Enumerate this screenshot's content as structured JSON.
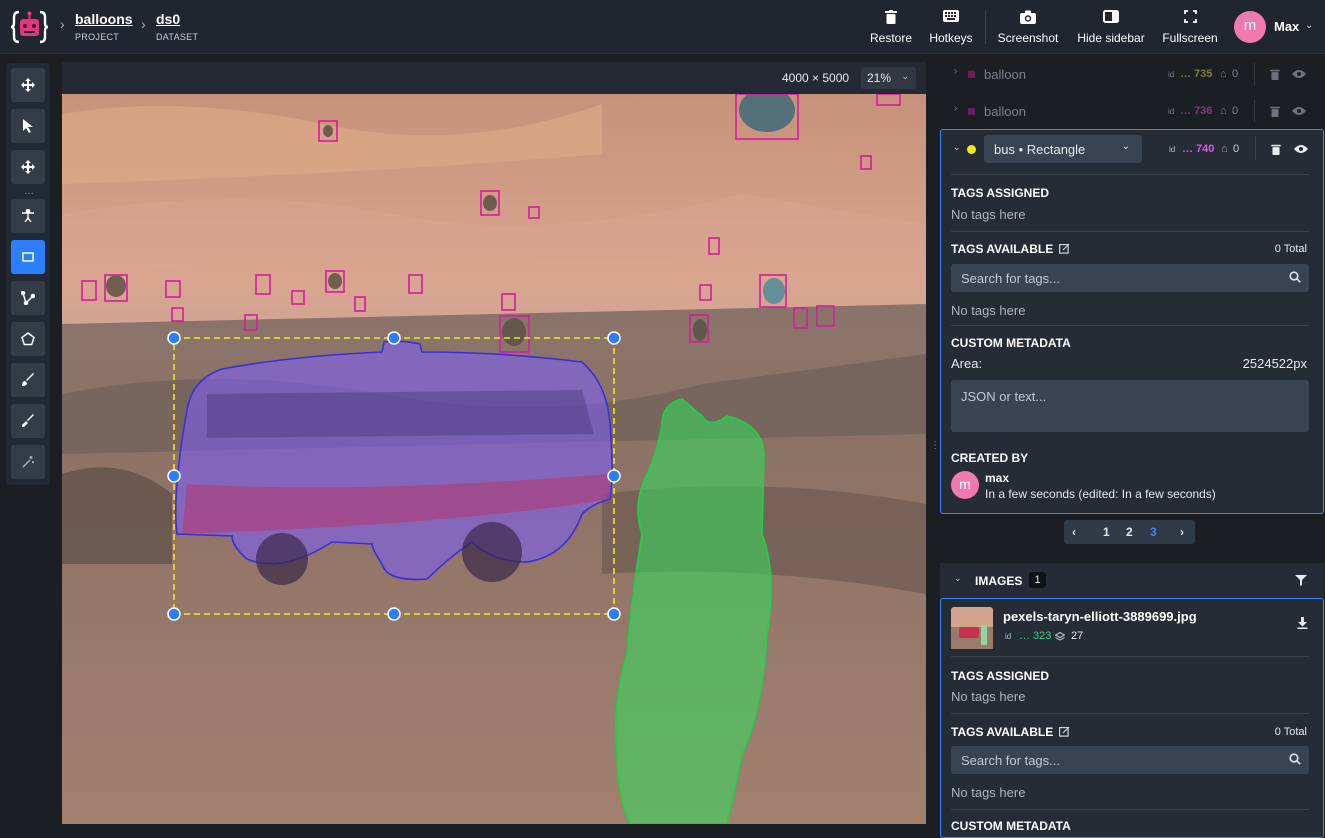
{
  "header": {
    "project": {
      "name": "balloons",
      "type": "PROJECT"
    },
    "dataset": {
      "name": "ds0",
      "type": "DATASET"
    },
    "actions": [
      {
        "label": "Restore",
        "icon": "trash-icon"
      },
      {
        "label": "Hotkeys",
        "icon": "keyboard-icon"
      },
      {
        "label": "Screenshot",
        "icon": "camera-icon"
      },
      {
        "label": "Hide sidebar",
        "icon": "sidebar-icon"
      },
      {
        "label": "Fullscreen",
        "icon": "fullscreen-icon"
      }
    ],
    "user": {
      "initial": "m",
      "name": "Max"
    }
  },
  "canvas": {
    "dimensions": "4000 × 5000",
    "zoom": "21%"
  },
  "objects": [
    {
      "class": "balloon",
      "id": "… 735",
      "tags": "0"
    },
    {
      "class": "balloon",
      "id": "… 736",
      "tags": "0"
    }
  ],
  "selected_object": {
    "class_label": "bus • Rectangle",
    "id_label": "id",
    "id": "… 740",
    "tags": "0",
    "color": "#f2e81e",
    "tags_assigned": {
      "title": "TAGS ASSIGNED",
      "empty": "No tags here"
    },
    "tags_available": {
      "title": "TAGS AVAILABLE",
      "total": "0 Total",
      "search_placeholder": "Search for tags...",
      "empty": "No tags here"
    },
    "custom_metadata": {
      "title": "CUSTOM METADATA",
      "area_label": "Area:",
      "area_value": "2524522px",
      "placeholder": "JSON or text..."
    },
    "created_by": {
      "title": "CREATED BY",
      "initial": "m",
      "name": "max",
      "time": "In a few seconds (edited: In a few seconds)"
    }
  },
  "pagination": {
    "pages": [
      "1",
      "2",
      "3"
    ],
    "current": "3"
  },
  "images": {
    "title": "IMAGES",
    "count": "1",
    "item": {
      "name": "pexels-taryn-elliott-3889699.jpg",
      "id_label": "id",
      "id": "… 323",
      "layers": "27"
    },
    "tags_assigned": {
      "title": "TAGS ASSIGNED",
      "empty": "No tags here"
    },
    "tags_available": {
      "title": "TAGS AVAILABLE",
      "total": "0 Total",
      "search_placeholder": "Search for tags...",
      "empty": "No tags here"
    },
    "custom_metadata": {
      "title": "CUSTOM METADATA"
    }
  },
  "colors": {
    "accent": "#2b7fff",
    "balloon_box": "#d61ca0",
    "bus_fill": "#7b5cff",
    "person_fill": "#2fe05a",
    "selection": "#f2e81e"
  }
}
